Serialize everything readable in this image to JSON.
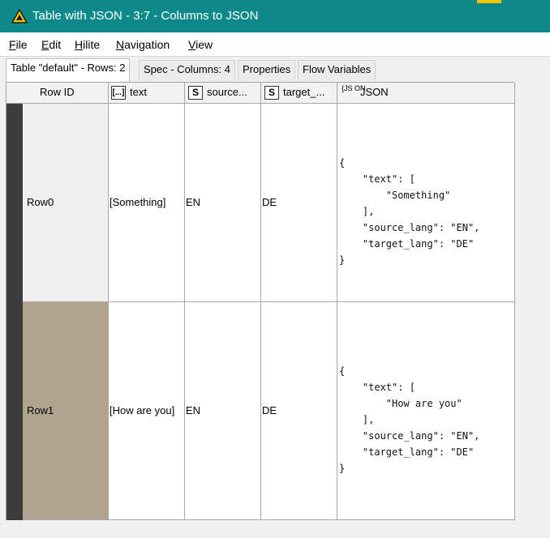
{
  "window": {
    "title": "Table with JSON - 3:7 - Columns to JSON",
    "accent_color": "#0f8a8a",
    "icon": "warning-triangle-icon"
  },
  "menu": [
    {
      "mnemonic": "F",
      "rest": "ile"
    },
    {
      "mnemonic": "E",
      "rest": "dit"
    },
    {
      "mnemonic": "H",
      "rest": "ilite"
    },
    {
      "mnemonic": "N",
      "rest": "avigation"
    },
    {
      "mnemonic": "V",
      "rest": "iew"
    }
  ],
  "tabs": [
    {
      "label": "Table \"default\" - Rows: 2",
      "active": true
    },
    {
      "label": "Spec - Columns: 4",
      "active": false
    },
    {
      "label": "Properties",
      "active": false
    },
    {
      "label": "Flow Variables",
      "active": false
    }
  ],
  "table": {
    "columns": [
      {
        "label": "Row ID",
        "type_icon": ""
      },
      {
        "label": "text",
        "type_icon": "[...]"
      },
      {
        "label": "source...",
        "type_icon": "S"
      },
      {
        "label": "target_...",
        "type_icon": "S"
      },
      {
        "label": "JSON",
        "type_icon": "{JS ON"
      }
    ],
    "rows": [
      {
        "row_id": "Row0",
        "text": "[Something]",
        "source": "EN",
        "target": "DE",
        "json": "{\n    \"text\": [\n        \"Something\"\n    ],\n    \"source_lang\": \"EN\",\n    \"target_lang\": \"DE\"\n}",
        "selected": false
      },
      {
        "row_id": "Row1",
        "text": "[How are you]",
        "source": "EN",
        "target": "DE",
        "json": "{\n    \"text\": [\n        \"How are you\"\n    ],\n    \"source_lang\": \"EN\",\n    \"target_lang\": \"DE\"\n}",
        "selected": true
      }
    ]
  }
}
